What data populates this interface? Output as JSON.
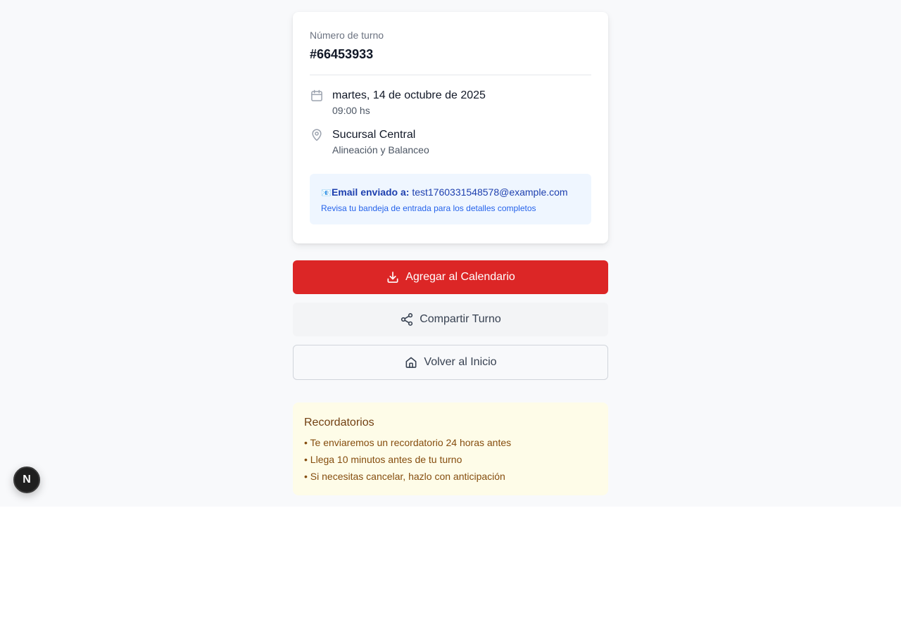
{
  "card": {
    "turno_label": "Número de turno",
    "turno_number": "#66453933",
    "date": "martes, 14 de octubre de 2025",
    "time": "09:00 hs",
    "location": "Sucursal Central",
    "service": "Alineación y Balanceo",
    "email_emoji": "📧",
    "email_label": "Email enviado a:",
    "email_address": "test1760331548578@example.com",
    "email_note": "Revisa tu bandeja de entrada para los detalles completos"
  },
  "buttons": {
    "calendar": "Agregar al Calendario",
    "share": "Compartir Turno",
    "home": "Volver al Inicio"
  },
  "reminders": {
    "title": "Recordatorios",
    "items": [
      "• Te enviaremos un recordatorio 24 horas antes",
      "• Llega 10 minutos antes de tu turno",
      "• Si necesitas cancelar, hazlo con anticipación"
    ]
  },
  "dev_badge": {
    "label": "N"
  },
  "colors": {
    "primary": "#dc2626",
    "page_background": "#f8f9fb",
    "info_box": "#eff6ff",
    "reminder_box": "#fefce8"
  },
  "icons": {
    "date": "calendar-icon",
    "location": "map-pin-icon",
    "calendar_button": "download-icon",
    "share_button": "share-icon",
    "home_button": "home-icon"
  }
}
